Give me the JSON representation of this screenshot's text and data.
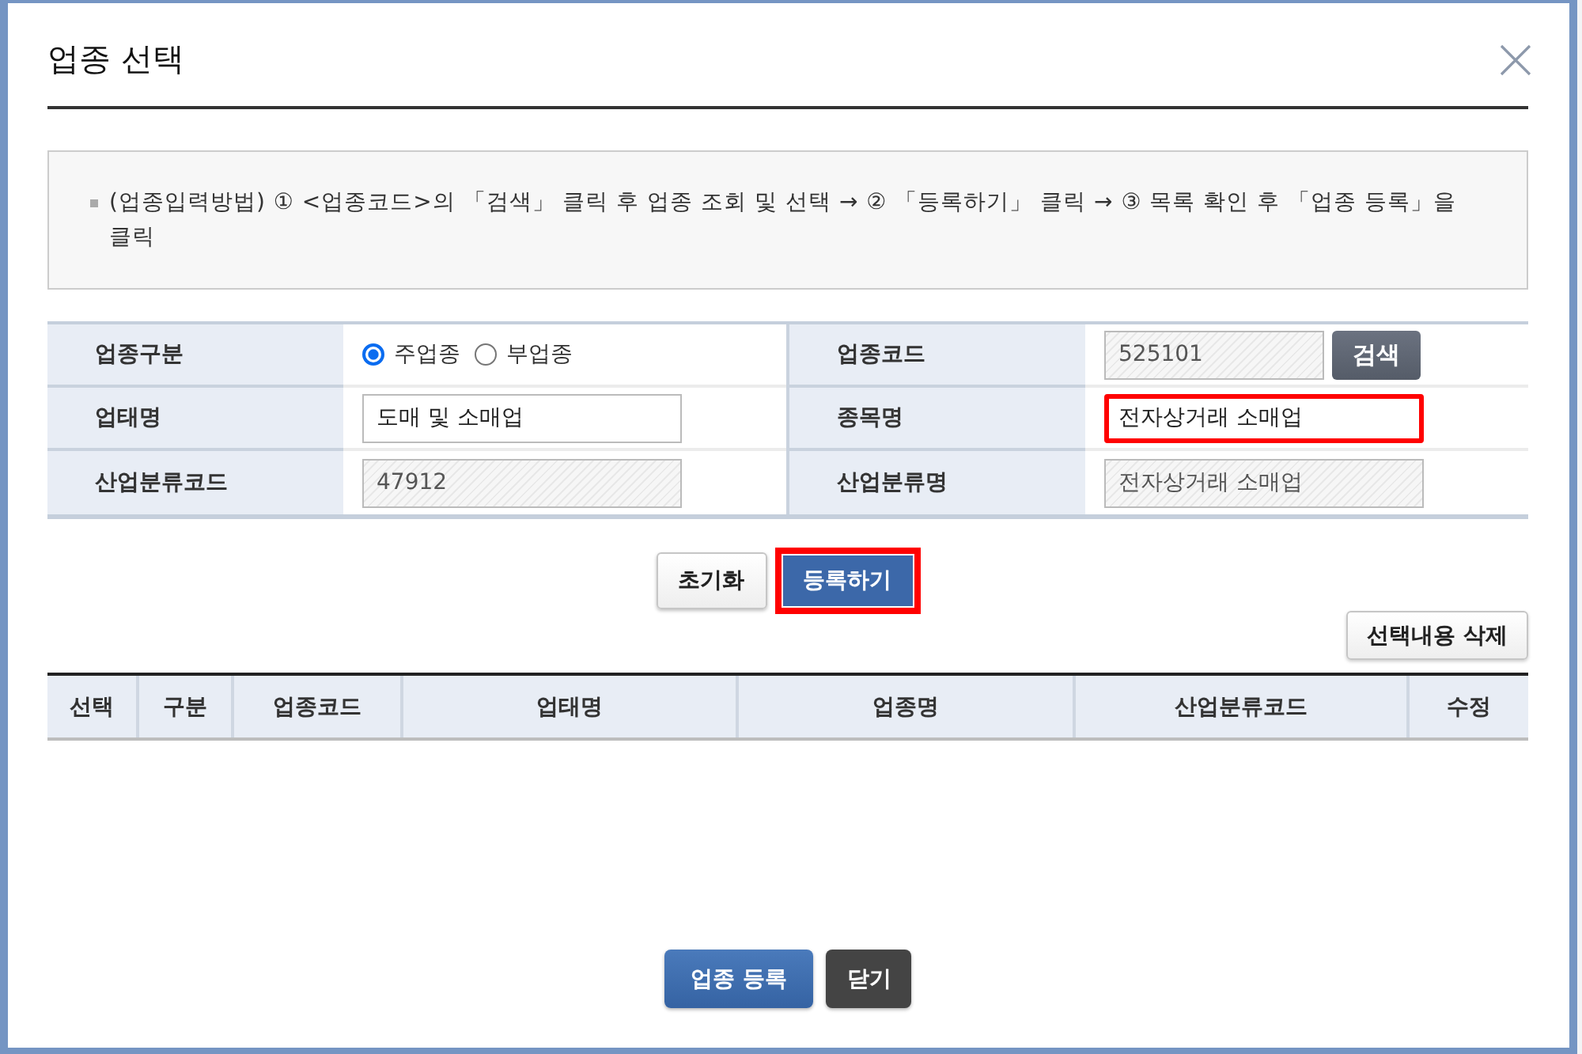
{
  "dialog": {
    "title": "업종 선택"
  },
  "instructions": "(업종입력방법) ① <업종코드>의 「검색」 클릭 후 업종 조회 및 선택 → ② 「등록하기」 클릭 → ③ 목록 확인 후 「업종 등록」을 클릭",
  "form": {
    "fields": [
      {
        "label": "업종구분",
        "kind": "radio",
        "options": [
          {
            "label": "주업종",
            "selected": true
          },
          {
            "label": "부업종",
            "selected": false
          }
        ]
      },
      {
        "label": "업종코드",
        "kind": "input",
        "value": "525101",
        "readonly": true,
        "highlighted": false,
        "button": "검색"
      },
      {
        "label": "업태명",
        "kind": "input",
        "value": "도매 및 소매업",
        "readonly": false,
        "highlighted": false
      },
      {
        "label": "종목명",
        "kind": "input",
        "value": "전자상거래 소매업",
        "readonly": false,
        "highlighted": true
      },
      {
        "label": "산업분류코드",
        "kind": "input",
        "value": "47912",
        "readonly": true,
        "highlighted": false
      },
      {
        "label": "산업분류명",
        "kind": "input",
        "value": "전자상거래 소매업",
        "readonly": true,
        "highlighted": false
      }
    ],
    "actions": [
      {
        "label": "초기화",
        "kind": "default",
        "highlighted": false
      },
      {
        "label": "등록하기",
        "kind": "primary",
        "highlighted": true
      }
    ]
  },
  "list": {
    "delete_button": "선택내용 삭제",
    "columns": [
      "선택",
      "구분",
      "업종코드",
      "업태명",
      "업종명",
      "산업분류코드",
      "수정"
    ]
  },
  "footer_buttons": [
    {
      "label": "업종 등록",
      "kind": "primary"
    },
    {
      "label": "닫기",
      "kind": "dark"
    }
  ]
}
